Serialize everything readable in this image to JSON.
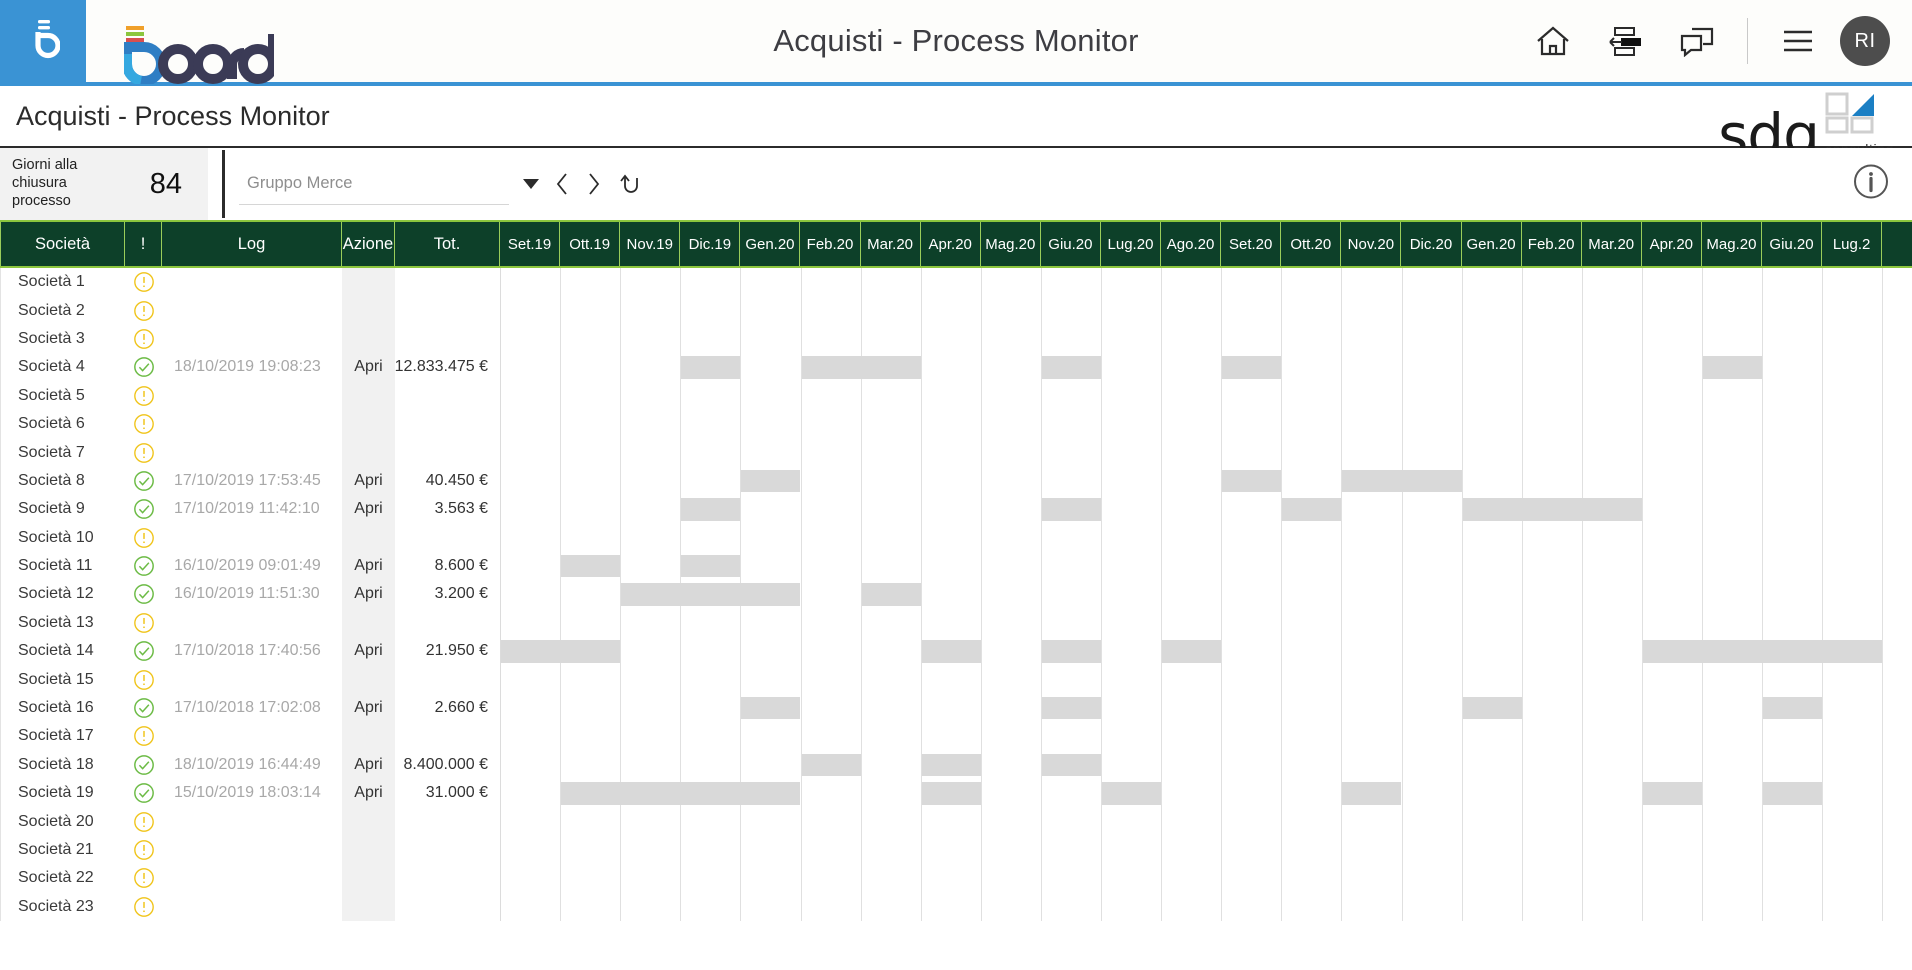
{
  "topbar": {
    "title": "Acquisti - Process Monitor",
    "logo_text": "board",
    "avatar_initials": "RI",
    "icons": [
      {
        "name": "home-icon",
        "label": "Home"
      },
      {
        "name": "layout-icon",
        "label": "Layout"
      },
      {
        "name": "chat-icon",
        "label": "Chat"
      },
      {
        "name": "menu-icon",
        "label": "Menu"
      }
    ]
  },
  "page": {
    "title": "Acquisti - Process Monitor",
    "logo_text": "sdg",
    "logo_sub": "consulting"
  },
  "filters": {
    "kpi_label": "Giorni alla chiusura processo",
    "kpi_value": "84",
    "select_placeholder": "Gruppo Merce",
    "prev_label": "‹",
    "next_label": "›",
    "reset_label": "reset",
    "info_label": "i"
  },
  "table": {
    "fixed_headers": [
      "Società",
      "!",
      "Log",
      "Azione",
      "Tot."
    ],
    "month_headers": [
      "Set.19",
      "Ott.19",
      "Nov.19",
      "Dic.19",
      "Gen.20",
      "Feb.20",
      "Mar.20",
      "Apr.20",
      "Mag.20",
      "Giu.20",
      "Lug.20",
      "Ago.20",
      "Set.20",
      "Ott.20",
      "Nov.20",
      "Dic.20",
      "Gen.20",
      "Feb.20",
      "Mar.20",
      "Apr.20",
      "Mag.20",
      "Giu.20",
      "Lug.2"
    ],
    "rows": [
      {
        "societa": "Società 1",
        "status": "warn",
        "log": "",
        "azione": "",
        "tot": "",
        "bars": []
      },
      {
        "societa": "Società 2",
        "status": "warn",
        "log": "",
        "azione": "",
        "tot": "",
        "bars": []
      },
      {
        "societa": "Società 3",
        "status": "warn",
        "log": "",
        "azione": "",
        "tot": "",
        "bars": []
      },
      {
        "societa": "Società 4",
        "status": "ok",
        "log": "18/10/2019 19:08:23",
        "azione": "Apri",
        "tot": "12.833.475 €",
        "bars": [
          [
            3,
            1
          ],
          [
            5,
            2
          ],
          [
            9,
            1
          ],
          [
            12,
            1
          ],
          [
            20,
            1
          ]
        ]
      },
      {
        "societa": "Società 5",
        "status": "warn",
        "log": "",
        "azione": "",
        "tot": "",
        "bars": []
      },
      {
        "societa": "Società 6",
        "status": "warn",
        "log": "",
        "azione": "",
        "tot": "",
        "bars": []
      },
      {
        "societa": "Società 7",
        "status": "warn",
        "log": "",
        "azione": "",
        "tot": "",
        "bars": []
      },
      {
        "societa": "Società 8",
        "status": "ok",
        "log": "17/10/2019 17:53:45",
        "azione": "Apri",
        "tot": "40.450 €",
        "bars": [
          [
            4,
            1
          ],
          [
            12,
            1
          ],
          [
            14,
            2
          ]
        ]
      },
      {
        "societa": "Società 9",
        "status": "ok",
        "log": "17/10/2019 11:42:10",
        "azione": "Apri",
        "tot": "3.563 €",
        "bars": [
          [
            3,
            1
          ],
          [
            9,
            1
          ],
          [
            13,
            1
          ],
          [
            16,
            3
          ]
        ]
      },
      {
        "societa": "Società 10",
        "status": "warn",
        "log": "",
        "azione": "",
        "tot": "",
        "bars": []
      },
      {
        "societa": "Società 11",
        "status": "ok",
        "log": "16/10/2019 09:01:49",
        "azione": "Apri",
        "tot": "8.600 €",
        "bars": [
          [
            1,
            1
          ],
          [
            3,
            1
          ]
        ]
      },
      {
        "societa": "Società 12",
        "status": "ok",
        "log": "16/10/2019 11:51:30",
        "azione": "Apri",
        "tot": "3.200 €",
        "bars": [
          [
            2,
            3
          ],
          [
            6,
            1
          ]
        ]
      },
      {
        "societa": "Società 13",
        "status": "warn",
        "log": "",
        "azione": "",
        "tot": "",
        "bars": []
      },
      {
        "societa": "Società 14",
        "status": "ok",
        "log": "17/10/2018 17:40:56",
        "azione": "Apri",
        "tot": "21.950 €",
        "bars": [
          [
            0,
            2
          ],
          [
            7,
            1
          ],
          [
            9,
            1
          ],
          [
            11,
            1
          ],
          [
            19,
            4
          ]
        ]
      },
      {
        "societa": "Società 15",
        "status": "warn",
        "log": "",
        "azione": "",
        "tot": "",
        "bars": []
      },
      {
        "societa": "Società 16",
        "status": "ok",
        "log": "17/10/2018 17:02:08",
        "azione": "Apri",
        "tot": "2.660 €",
        "bars": [
          [
            4,
            1
          ],
          [
            9,
            1
          ],
          [
            16,
            1
          ],
          [
            21,
            1
          ]
        ]
      },
      {
        "societa": "Società 17",
        "status": "warn",
        "log": "",
        "azione": "",
        "tot": "",
        "bars": []
      },
      {
        "societa": "Società 18",
        "status": "ok",
        "log": "18/10/2019 16:44:49",
        "azione": "Apri",
        "tot": "8.400.000 €",
        "bars": [
          [
            5,
            1
          ],
          [
            7,
            1
          ],
          [
            9,
            1
          ]
        ]
      },
      {
        "societa": "Società 19",
        "status": "ok",
        "log": "15/10/2019 18:03:14",
        "azione": "Apri",
        "tot": "31.000 €",
        "bars": [
          [
            1,
            4
          ],
          [
            7,
            1
          ],
          [
            10,
            1
          ],
          [
            14,
            1
          ],
          [
            19,
            1
          ],
          [
            21,
            1
          ]
        ]
      },
      {
        "societa": "Società 20",
        "status": "warn",
        "log": "",
        "azione": "",
        "tot": "",
        "bars": []
      },
      {
        "societa": "Società 21",
        "status": "warn",
        "log": "",
        "azione": "",
        "tot": "",
        "bars": []
      },
      {
        "societa": "Società 22",
        "status": "warn",
        "log": "",
        "azione": "",
        "tot": "",
        "bars": []
      },
      {
        "societa": "Società 23",
        "status": "warn",
        "log": "",
        "azione": "",
        "tot": "",
        "bars": []
      }
    ]
  },
  "colors": {
    "brand_blue": "#3a93d4",
    "header_green": "#0d4029",
    "header_border_green": "#8cc63e",
    "warn_yellow": "#f0c419",
    "ok_green": "#6cbb45",
    "bar_gray": "#d9d9d9"
  }
}
